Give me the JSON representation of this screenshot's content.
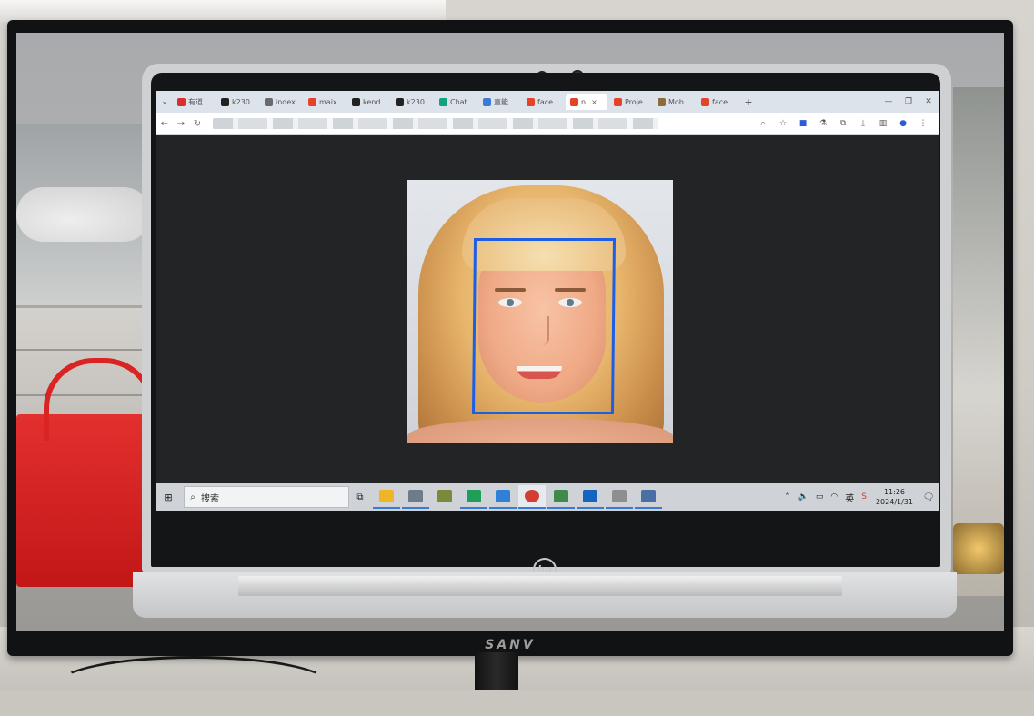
{
  "scene": {
    "description_kind": "photo of a monitor showing a laptop running a face detection demo",
    "monitor_brand": "SANV",
    "laptop_brand": "hp",
    "detection_box_color": "#1c5ee6"
  },
  "browser": {
    "tabs": [
      {
        "label": "有道",
        "icon": "youdao-icon",
        "color": "#d9302f"
      },
      {
        "label": "k230",
        "icon": "github-icon",
        "color": "#222222"
      },
      {
        "label": "index",
        "icon": "globe-icon",
        "color": "#6a6a6a"
      },
      {
        "label": "maix",
        "icon": "gitlab-icon",
        "color": "#e24329"
      },
      {
        "label": "kend",
        "icon": "github-icon",
        "color": "#222222"
      },
      {
        "label": "k230",
        "icon": "github-icon",
        "color": "#222222"
      },
      {
        "label": "Chat",
        "icon": "chat-icon",
        "color": "#10a37f"
      },
      {
        "label": "直能",
        "icon": "circle-icon",
        "color": "#3b7bd6"
      },
      {
        "label": "face",
        "icon": "gitlab-icon",
        "color": "#e24329"
      },
      {
        "label": "n",
        "icon": "gitlab-icon",
        "color": "#e24329",
        "active": true
      },
      {
        "label": "Proje",
        "icon": "gitlab-icon",
        "color": "#e24329"
      },
      {
        "label": "Mob",
        "icon": "picture-icon",
        "color": "#8a6d3b"
      },
      {
        "label": "face",
        "icon": "gitlab-icon",
        "color": "#e24329"
      }
    ],
    "tab_close": "×",
    "new_tab": "+"
  },
  "taskbar": {
    "search_placeholder": "搜索",
    "apps": [
      {
        "name": "file-explorer",
        "color": "#f0b429",
        "state": "open"
      },
      {
        "name": "chat-app",
        "color": "#6e7b8b",
        "state": "open"
      },
      {
        "name": "tools-app",
        "color": "#7a8a3a",
        "state": "none"
      },
      {
        "name": "editor-app",
        "color": "#1f9e5a",
        "state": "open"
      },
      {
        "name": "vscode",
        "color": "#2f80d6",
        "state": "open"
      },
      {
        "name": "chrome",
        "color": "#d23f31",
        "state": "active"
      },
      {
        "name": "notepad-app",
        "color": "#3f8a4a",
        "state": "open"
      },
      {
        "name": "outlook-app",
        "color": "#1565c0",
        "state": "open"
      },
      {
        "name": "typora-app",
        "color": "#8e8e8e",
        "state": "open"
      },
      {
        "name": "viewer-app",
        "color": "#4a6fa5",
        "state": "open"
      }
    ],
    "ime": "英",
    "time": "11:26",
    "date": "2024/1/31"
  }
}
